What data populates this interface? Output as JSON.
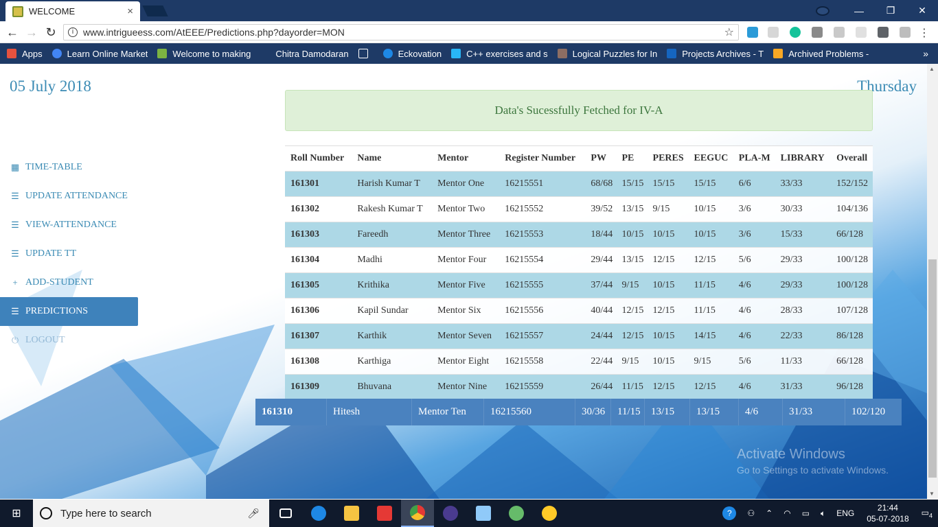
{
  "browser": {
    "tab_title": "WELCOME",
    "tab_close": "×",
    "url": "www.intrigueess.com/AtEEE/Predictions.php?dayorder=MON",
    "bookmarks": [
      {
        "label": "Apps",
        "color": "#e5523f"
      },
      {
        "label": "Learn Online Market",
        "color": "#4285f4"
      },
      {
        "label": "Welcome to making",
        "color": "#7cb342"
      },
      {
        "label": "Chitra Damodaran",
        "color": "#1e3a66"
      },
      {
        "label": "",
        "color": "#ffffff"
      },
      {
        "label": "Eckovation",
        "color": "#1e88e5"
      },
      {
        "label": "C++ exercises and s",
        "color": "#29b6f6"
      },
      {
        "label": "Logical Puzzles for In",
        "color": "#8d6e63"
      },
      {
        "label": "Projects Archives - T",
        "color": "#1565c0"
      },
      {
        "label": "Archived Problems -",
        "color": "#f9a825"
      }
    ],
    "bookmarks_more": "»"
  },
  "page": {
    "date": "05 July 2018",
    "day": "Thursday",
    "alert": "Data's Sucessfully Fetched for IV-A"
  },
  "nav": [
    {
      "label": "TIME-TABLE",
      "icon": "calendar-icon",
      "glyph": "▦"
    },
    {
      "label": "UPDATE ATTENDANCE",
      "icon": "list-icon",
      "glyph": "☰"
    },
    {
      "label": "VIEW-ATTENDANCE",
      "icon": "list-icon",
      "glyph": "☰"
    },
    {
      "label": "UPDATE TT",
      "icon": "list-icon",
      "glyph": "☰"
    },
    {
      "label": "ADD-STUDENT",
      "icon": "plus-icon",
      "glyph": "+"
    },
    {
      "label": "PREDICTIONS",
      "icon": "list-icon",
      "glyph": "☰"
    },
    {
      "label": "LOGOUT",
      "icon": "power-icon",
      "glyph": "⏻"
    }
  ],
  "table": {
    "headers": [
      "Roll Number",
      "Name",
      "Mentor",
      "Register Number",
      "PW",
      "PE",
      "PERES",
      "EEGUC",
      "PLA-M",
      "LIBRARY",
      "Overall"
    ],
    "rows": [
      [
        "161301",
        "Harish Kumar T",
        "Mentor One",
        "16215551",
        "68/68",
        "15/15",
        "15/15",
        "15/15",
        "6/6",
        "33/33",
        "152/152"
      ],
      [
        "161302",
        "Rakesh Kumar T",
        "Mentor Two",
        "16215552",
        "39/52",
        "13/15",
        "9/15",
        "10/15",
        "3/6",
        "30/33",
        "104/136"
      ],
      [
        "161303",
        "Fareedh",
        "Mentor Three",
        "16215553",
        "18/44",
        "10/15",
        "10/15",
        "10/15",
        "3/6",
        "15/33",
        "66/128"
      ],
      [
        "161304",
        "Madhi",
        "Mentor Four",
        "16215554",
        "29/44",
        "13/15",
        "12/15",
        "12/15",
        "5/6",
        "29/33",
        "100/128"
      ],
      [
        "161305",
        "Krithika",
        "Mentor Five",
        "16215555",
        "37/44",
        "9/15",
        "10/15",
        "11/15",
        "4/6",
        "29/33",
        "100/128"
      ],
      [
        "161306",
        "Kapil Sundar",
        "Mentor Six",
        "16215556",
        "40/44",
        "12/15",
        "12/15",
        "11/15",
        "4/6",
        "28/33",
        "107/128"
      ],
      [
        "161307",
        "Karthik",
        "Mentor Seven",
        "16215557",
        "24/44",
        "12/15",
        "10/15",
        "14/15",
        "4/6",
        "22/33",
        "86/128"
      ],
      [
        "161308",
        "Karthiga",
        "Mentor Eight",
        "16215558",
        "22/44",
        "9/15",
        "10/15",
        "9/15",
        "5/6",
        "11/33",
        "66/128"
      ],
      [
        "161309",
        "Bhuvana",
        "Mentor Nine",
        "16215559",
        "26/44",
        "11/15",
        "12/15",
        "12/15",
        "4/6",
        "31/33",
        "96/128"
      ]
    ],
    "hover_row": [
      "161310",
      "Hitesh",
      "Mentor Ten",
      "16215560",
      "30/36",
      "11/15",
      "13/15",
      "13/15",
      "4/6",
      "31/33",
      "102/120"
    ]
  },
  "watermark": {
    "line1": "Activate Windows",
    "line2": "Go to Settings to activate Windows."
  },
  "taskbar": {
    "search_placeholder": "Type here to search",
    "apps": [
      {
        "name": "task-view",
        "color": "#ffffff"
      },
      {
        "name": "edge",
        "color": "#1e88e5"
      },
      {
        "name": "file-explorer",
        "color": "#f5c342"
      },
      {
        "name": "media-app",
        "color": "#e53935"
      },
      {
        "name": "chrome",
        "color": "#43a047"
      },
      {
        "name": "eclipse",
        "color": "#4a3b8f"
      },
      {
        "name": "virtualbox",
        "color": "#90caf9"
      },
      {
        "name": "atom",
        "color": "#66bb6a"
      },
      {
        "name": "paint",
        "color": "#ffca28"
      }
    ],
    "lang": "ENG",
    "time": "21:44",
    "date": "05-07-2018",
    "notifications": "4"
  },
  "colors": {
    "accent": "#3b8bb4",
    "active_nav": "#3e82bb",
    "row_highlight": "#add8e6",
    "hover_row": "#4a82bf",
    "alert_bg": "#dff0d8",
    "alert_text": "#3c763d",
    "chrome_frame": "#1e3a66"
  }
}
